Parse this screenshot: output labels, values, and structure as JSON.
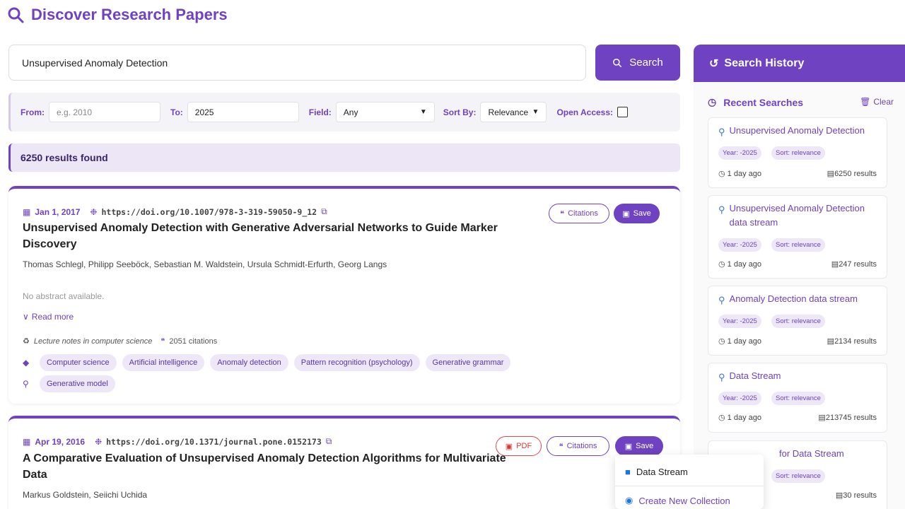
{
  "page": {
    "title": "Discover Research Papers"
  },
  "search": {
    "query": "Unsupervised Anomaly Detection",
    "button_label": "Search"
  },
  "filters": {
    "from_label": "From:",
    "from_placeholder": "e.g. 2010",
    "to_label": "To:",
    "to_value": "2025",
    "field_label": "Field:",
    "field_value": "Any",
    "sort_label": "Sort By:",
    "sort_value": "Relevance",
    "open_access_label": "Open Access:"
  },
  "results": {
    "count_text": "6250  results found"
  },
  "papers": [
    {
      "date": "Jan 1, 2017",
      "doi": "https://doi.org/10.1007/978-3-319-59050-9_12",
      "title": "Unsupervised Anomaly Detection with Generative Adversarial Networks to Guide Marker Discovery",
      "authors": "Thomas Schlegl, Philipp Seeböck, Sebastian M. Waldstein, Ursula Schmidt-Erfurth, Georg Langs",
      "abstract": "No abstract available.",
      "read_more": "Read more",
      "venue": "Lecture notes in computer science",
      "citations": "2051 citations",
      "topics": [
        "Computer science",
        "Artificial intelligence",
        "Anomaly detection",
        "Pattern recognition (psychology)",
        "Generative grammar"
      ],
      "keywords": [
        "Generative model"
      ],
      "citations_btn": "Citations",
      "save_btn": "Save"
    },
    {
      "date": "Apr 19, 2016",
      "doi": "https://doi.org/10.1371/journal.pone.0152173",
      "title": "A Comparative Evaluation of Unsupervised Anomaly Detection Algorithms for Multivariate Data",
      "authors": "Markus Goldstein, Seiichi Uchida",
      "pdf_btn": "PDF",
      "citations_btn": "Citations",
      "save_btn": "Save"
    }
  ],
  "sidebar": {
    "header": "Search History",
    "recent_label": "Recent Searches",
    "clear_label": "Clear",
    "history": [
      {
        "query": "Unsupervised Anomaly Detection",
        "year": "Year: -2025",
        "sort": "Sort: relevance",
        "time": "1 day ago",
        "results": "6250 results"
      },
      {
        "query": "Unsupervised Anomaly Detection data stream",
        "year": "Year: -2025",
        "sort": "Sort: relevance",
        "time": "1 day ago",
        "results": "247 results"
      },
      {
        "query": "Anomaly Detection data stream",
        "year": "Year: -2025",
        "sort": "Sort: relevance",
        "time": "1 day ago",
        "results": "2134 results"
      },
      {
        "query": "Data Stream",
        "year": "Year: -2025",
        "sort": "Sort: relevance",
        "time": "1 day ago",
        "results": "213745 results"
      },
      {
        "query_partial": "for Data Stream",
        "sort": "Sort: relevance",
        "results": "30 results"
      }
    ]
  },
  "dropdown": {
    "item_collection": "Data Stream",
    "create_label": "Create New Collection"
  },
  "colors": {
    "accent": "#6f42c1",
    "link_blue": "#3b78d8",
    "pdf_red": "#d03a3a"
  }
}
